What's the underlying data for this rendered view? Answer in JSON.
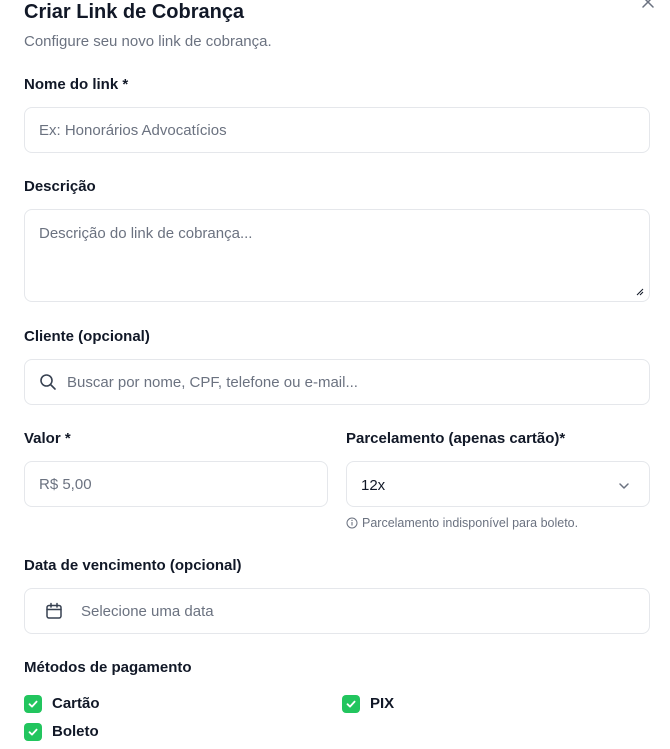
{
  "dialog": {
    "title": "Criar Link de Cobrança",
    "subtitle": "Configure seu novo link de cobrança."
  },
  "fields": {
    "name_label": "Nome do link *",
    "name_placeholder": "Ex: Honorários Advocatícios",
    "description_label": "Descrição",
    "description_placeholder": "Descrição do link de cobrança...",
    "client_label": "Cliente (opcional)",
    "client_placeholder": "Buscar por nome, CPF, telefone ou e-mail...",
    "value_label": "Valor *",
    "value_placeholder": "R$ 5,00",
    "installments_label": "Parcelamento (apenas cartão)*",
    "installments_value": "12x",
    "installments_hint": "Parcelamento indisponível para boleto.",
    "due_date_label": "Data de vencimento (opcional)",
    "due_date_placeholder": "Selecione uma data"
  },
  "payment": {
    "label": "Métodos de pagamento",
    "methods": [
      {
        "label": "Cartão",
        "checked": true
      },
      {
        "label": "PIX",
        "checked": true
      },
      {
        "label": "Boleto",
        "checked": true
      }
    ]
  },
  "colors": {
    "accent": "#22c55e",
    "border": "#e5e7eb",
    "muted_text": "#6b7280"
  }
}
